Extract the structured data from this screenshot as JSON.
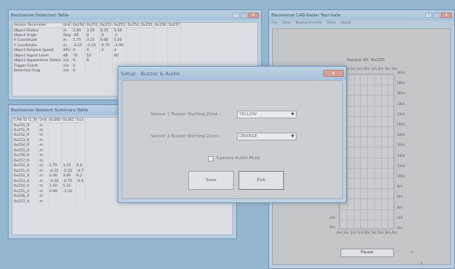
{
  "win_sensor": {
    "title": "Backsense Detection Table",
    "headers": [
      "Sensor Parameter",
      "Unit",
      "0x250",
      "0x251",
      "0x252",
      "0x253",
      "0x254",
      "0x255",
      "0x256",
      "0x257"
    ],
    "rows": [
      [
        "Object Radius",
        "m",
        "2.00",
        "3.25",
        "6.25",
        "5.50",
        "",
        "",
        "",
        ""
      ],
      [
        "Object Angle",
        "Deg",
        "-85",
        "0",
        "-5",
        "-2",
        "",
        "",
        "",
        ""
      ],
      [
        "X Coordinate",
        "m",
        "1.75",
        "3.25",
        "6.00",
        "5.50",
        "",
        "",
        "",
        ""
      ],
      [
        "Y Coordinate",
        "m",
        "-0.25",
        "-0.25",
        "-0.75",
        "-1.00",
        "",
        "",
        "",
        ""
      ],
      [
        "Object Relative Speed",
        "KPH",
        "0",
        "0",
        "-2",
        "4",
        "",
        "",
        "",
        ""
      ],
      [
        "Object Signal Level",
        "dB",
        "70",
        "52",
        "",
        "60",
        "",
        "",
        "",
        ""
      ],
      [
        "Object Appearance Status",
        "n/a",
        "8",
        "8",
        "",
        "",
        "",
        "",
        "",
        ""
      ],
      [
        "Trigger Event",
        "n/a",
        "0",
        "",
        "",
        "",
        "",
        "",
        "",
        ""
      ],
      [
        "Detection Flag",
        "n/a",
        "0",
        "",
        "",
        "",
        "",
        "",
        "",
        ""
      ]
    ]
  },
  "win_summary": {
    "title": "Backsense Network Summary Table",
    "headers": [
      "CAN ID (1_8)",
      "Unit",
      "0x360",
      "0x361",
      "0x3"
    ],
    "rows": [
      [
        "0x250_R",
        "m",
        "",
        "",
        ""
      ],
      [
        "0x251_R",
        "m",
        "",
        "",
        ""
      ],
      [
        "0x252_R",
        "m",
        "",
        "",
        ""
      ],
      [
        "0x253_R",
        "m",
        "",
        "",
        ""
      ],
      [
        "0x254_R",
        "m",
        "",
        "",
        ""
      ],
      [
        "0x255_R",
        "m",
        "",
        "",
        ""
      ],
      [
        "0x256_R",
        "m",
        "",
        "",
        ""
      ],
      [
        "0x257_R",
        "m",
        "",
        "",
        ""
      ],
      [
        "0x250_X",
        "m",
        "1.75",
        "3.25",
        "6.0"
      ],
      [
        "0x251_X",
        "m",
        "-0.25",
        "-0.25",
        "-0.7"
      ],
      [
        "0x252_X",
        "m",
        "2.00",
        "3.00",
        "6.2"
      ],
      [
        "0x253_X",
        "m",
        "-0.50",
        "-0.75",
        "-0.5"
      ],
      [
        "0x254_X",
        "m",
        "1.50",
        "5.25",
        ""
      ],
      [
        "0x255_X",
        "m",
        "0.00",
        "-1.50",
        ""
      ],
      [
        "0x256_X",
        "m",
        "",
        "",
        ""
      ],
      [
        "0x257_X",
        "m",
        "",
        "",
        ""
      ]
    ]
  },
  "win_radar": {
    "title": "Backsense CAN Radar Tool Gate",
    "menu": [
      "File",
      "View",
      "Measurements",
      "Tools",
      "About"
    ],
    "sensor_label": "Sensor ID: 0x250",
    "top_ticks": [
      "4m",
      "3m",
      "2m",
      "1m",
      "0m",
      "1m",
      "2m",
      "3m",
      "4m"
    ],
    "right_ticks": [
      "30m",
      "28m",
      "26m",
      "24m",
      "22m",
      "20m",
      "18m",
      "16m",
      "14m",
      "12m",
      "10m",
      "8m",
      "6m",
      "4m",
      "2m",
      "0m"
    ],
    "left_ticks": [
      "2m",
      "0m"
    ],
    "pause_label": "Pause",
    "axis_x": "x",
    "axis_y": "y"
  },
  "dialog": {
    "title": "Setup - Buzzer & Audio",
    "sensor1_label": "Sensor 1 Buzzer Starting Zone :",
    "sensor1_value": "YELLOW",
    "sensor2_label": "Sensor 2 Buzzer Starting Zone :",
    "sensor2_value": "ORANGE",
    "mute_label": "Camera Audio Mute",
    "save_label": "Save",
    "exit_label": "Exit",
    "close_glyph": "x"
  }
}
